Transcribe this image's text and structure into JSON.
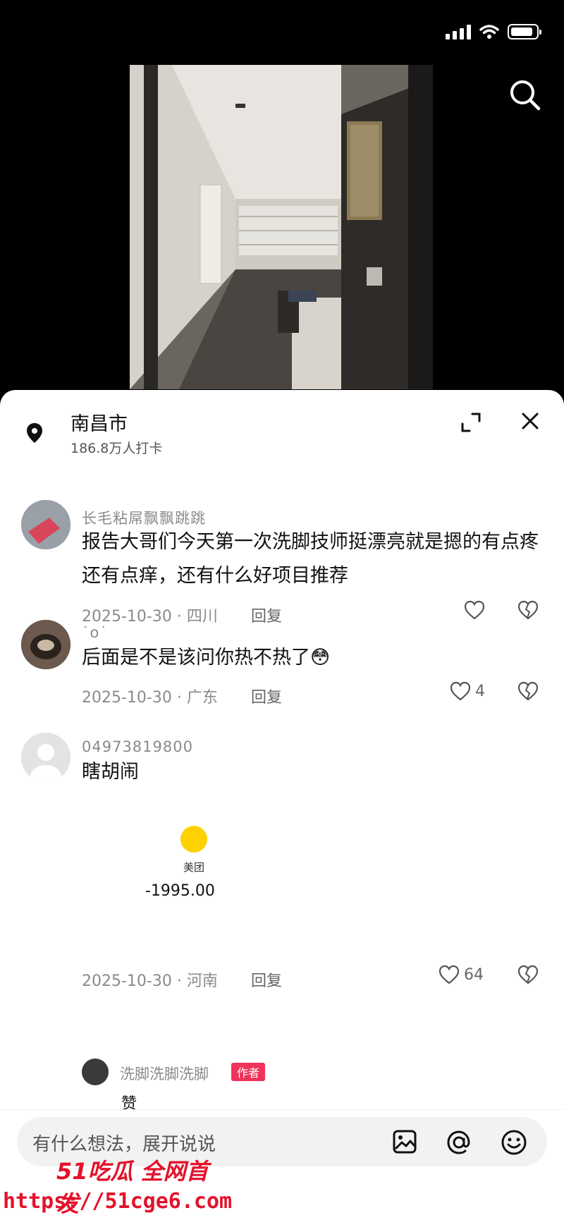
{
  "location": {
    "title": "南昌市",
    "subtitle": "186.8万人打卡"
  },
  "comments": [
    {
      "username": "长毛粘屌飘飘跳跳",
      "text": "报告大哥们今天第一次洗脚技师挺漂亮就是摁的有点疼还有点痒，还有什么好项目推荐",
      "date_region": "2025-10-30 · 四川",
      "reply_label": "回复",
      "likes": ""
    },
    {
      "username": "˙o˙",
      "text": "后面是不是该问你热不热了",
      "emoji": "😳",
      "date_region": "2025-10-30 · 广东",
      "reply_label": "回复",
      "likes": "4"
    },
    {
      "username": "04973819800",
      "text": "瞎胡闹",
      "receipt_label": "美团",
      "receipt_amount": "-1995.00",
      "date_region": "2025-10-30 · 河南",
      "reply_label": "回复",
      "likes": "64"
    }
  ],
  "sub_reply": {
    "username": "洗脚洗脚洗脚",
    "badge": "作者",
    "text": "赞"
  },
  "input": {
    "placeholder": "有什么想法，展开说说"
  },
  "watermark": {
    "brand": "51吃瓜 全网首发",
    "url": "https://51cge6.com"
  },
  "colors": {
    "accent": "#e3122b",
    "badge": "#f0335a"
  }
}
